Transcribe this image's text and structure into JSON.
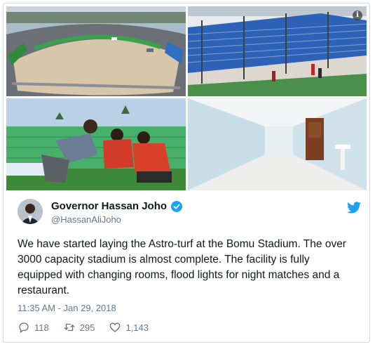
{
  "tweet": {
    "author_name": "Governor Hassan Joho",
    "handle": "@HassanAliJoho",
    "text": "We have started laying the Astro-turf at the Bomu Stadium. The over 3000 capacity stadium is almost complete. The facility is fully equipped with changing rooms, flood lights for night matches and a restaurant.",
    "timestamp": "11:35 AM - Jan 29, 2018",
    "replies": "118",
    "retweets": "295",
    "likes": "1,143"
  },
  "icons": {
    "info": "i",
    "brand": "twitter-bird-icon",
    "verified": "verified-badge-icon",
    "reply": "reply-icon",
    "retweet": "retweet-icon",
    "like": "heart-icon"
  },
  "colors": {
    "brand_blue": "#1da1f2",
    "text_primary": "#14171a",
    "text_secondary": "#657786",
    "border": "#cfd9de"
  }
}
